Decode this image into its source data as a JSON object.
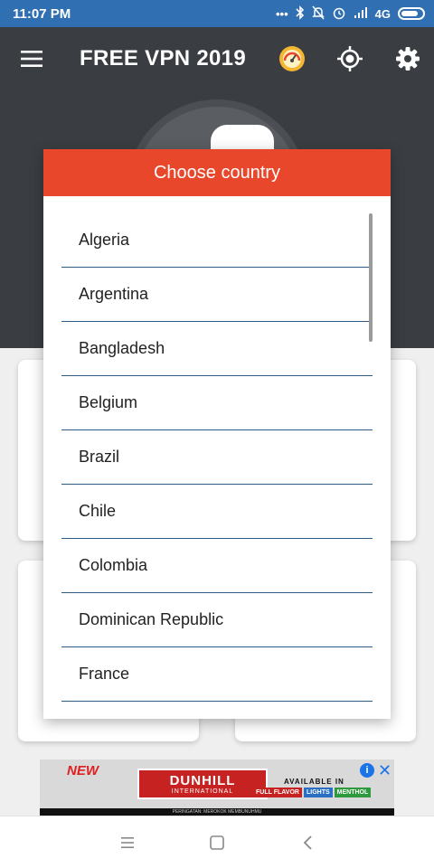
{
  "status_bar": {
    "time": "11:07 PM",
    "network": "4G"
  },
  "toolbar": {
    "title": "FREE VPN 2019"
  },
  "dialog": {
    "title": "Choose country",
    "countries": [
      "Algeria",
      "Argentina",
      "Bangladesh",
      "Belgium",
      "Brazil",
      "Chile",
      "Colombia",
      "Dominican Republic",
      "France"
    ]
  },
  "ad": {
    "badge": "NEW",
    "brand": "DUNHILL",
    "brand_sub": "INTERNATIONAL",
    "available": "AVAILABLE IN",
    "tags": [
      "FULL FLAVOR",
      "LIGHTS",
      "MENTHOL"
    ],
    "warning": "PERINGATAN: MEROKOK MEMBUNUHMU"
  },
  "colors": {
    "status_bar": "#2f6fb2",
    "toolbar": "#3a3e42",
    "dialog_header": "#e8472b",
    "divider": "#2c5a86"
  },
  "icons": [
    "menu-icon",
    "speedometer-icon",
    "location-target-icon",
    "gear-icon",
    "bluetooth-icon",
    "mute-icon",
    "alarm-icon",
    "signal-icon",
    "battery-icon",
    "info-icon",
    "close-icon",
    "recent-apps-icon",
    "home-icon",
    "back-icon"
  ]
}
